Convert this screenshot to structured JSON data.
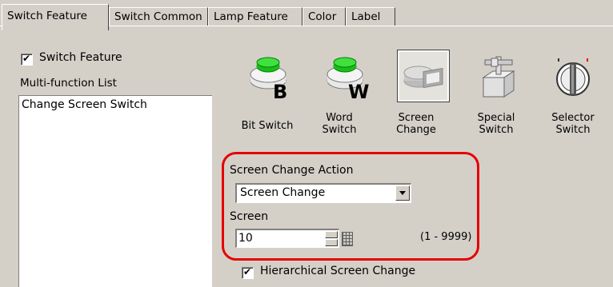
{
  "tabs": [
    "Switch Feature",
    "Switch Common",
    "Lamp Feature",
    "Color",
    "Label"
  ],
  "switch_feature_checkbox": {
    "label": "Switch Feature",
    "checked": true
  },
  "multi_function_list": {
    "label": "Multi-function List",
    "items": [
      "Change Screen Switch"
    ]
  },
  "switch_types": [
    {
      "label": "Bit Switch",
      "icon": "bit-switch-icon"
    },
    {
      "label": "Word Switch",
      "icon": "word-switch-icon"
    },
    {
      "label": "Screen Change",
      "icon": "screen-change-icon"
    },
    {
      "label": "Special Switch",
      "icon": "special-switch-icon"
    },
    {
      "label": "Selector Switch",
      "icon": "selector-switch-icon"
    }
  ],
  "screen_change_action": {
    "label": "Screen Change Action",
    "value": "Screen Change"
  },
  "screen": {
    "label": "Screen",
    "value": "10",
    "range": "(1 - 9999)"
  },
  "hierarchical_checkbox": {
    "label": "Hierarchical Screen Change",
    "checked": true
  },
  "colors": {
    "highlight": "#e60000",
    "panel": "#d4d0c8"
  }
}
